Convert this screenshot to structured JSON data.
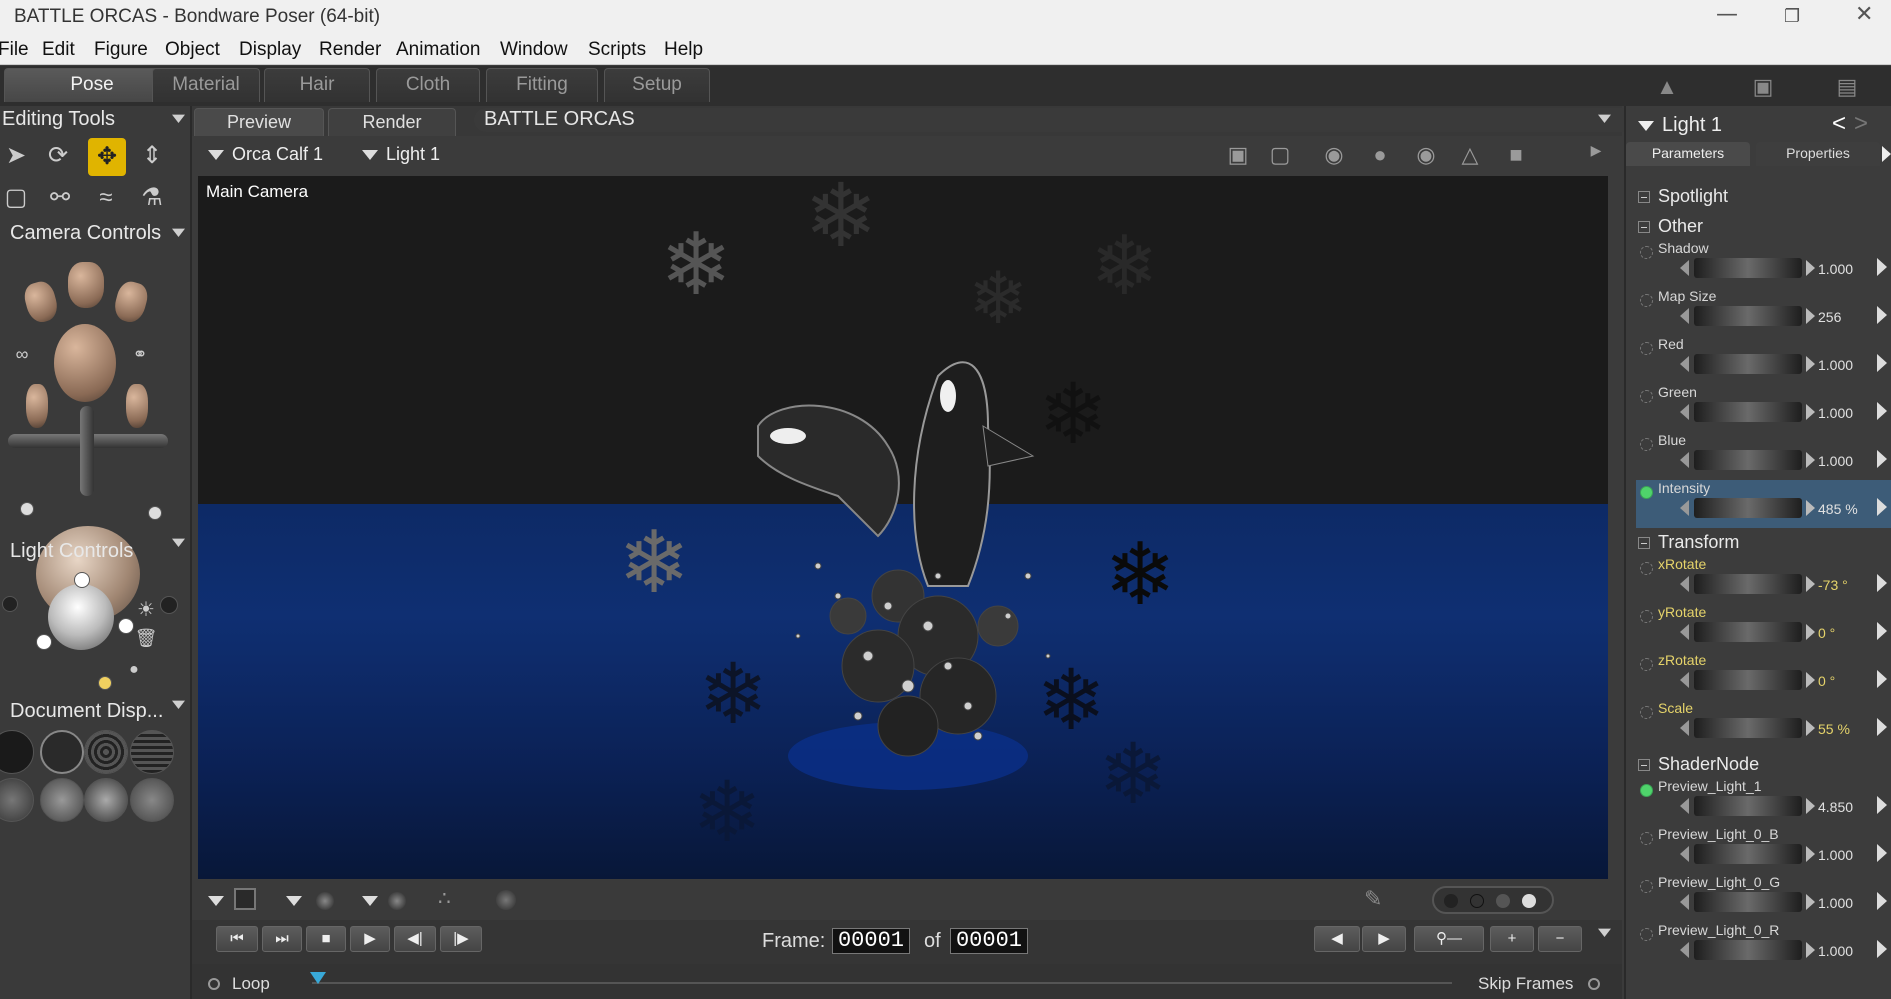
{
  "window": {
    "title": "BATTLE ORCAS - Bondware Poser (64-bit)"
  },
  "menu": [
    "File",
    "Edit",
    "Figure",
    "Object",
    "Display",
    "Render",
    "Animation",
    "Window",
    "Scripts",
    "Help"
  ],
  "rooms": [
    "Pose",
    "Material",
    "Hair",
    "Cloth",
    "Fitting",
    "Setup"
  ],
  "left": {
    "editing_tools": "Editing Tools",
    "camera_controls": "Camera Controls",
    "light_controls": "Light Controls",
    "document_display": "Document Disp..."
  },
  "viewport": {
    "tabs": [
      "Preview",
      "Render"
    ],
    "doc_title": "BATTLE ORCAS",
    "figure_select": "Orca Calf 1",
    "actor_select": "Light 1",
    "camera_label": "Main Camera"
  },
  "playback": {
    "frame_label": "Frame:",
    "frame_value": "00001",
    "of_label": "of",
    "total_frames": "00001",
    "loop_label": "Loop",
    "skip_frames_label": "Skip Frames"
  },
  "panel": {
    "title": "Light 1",
    "tabs": [
      "Parameters",
      "Properties"
    ],
    "sections": {
      "spotlight": "Spotlight",
      "other": "Other",
      "transform": "Transform",
      "shader": "ShaderNode"
    },
    "other_params": [
      {
        "label": "Shadow",
        "value": "1.000"
      },
      {
        "label": "Map Size",
        "value": "256"
      },
      {
        "label": "Red",
        "value": "1.000"
      },
      {
        "label": "Green",
        "value": "1.000"
      },
      {
        "label": "Blue",
        "value": "1.000"
      },
      {
        "label": "Intensity",
        "value": "485 %"
      }
    ],
    "transform_params": [
      {
        "label": "xRotate",
        "value": "-73 °"
      },
      {
        "label": "yRotate",
        "value": "0 °"
      },
      {
        "label": "zRotate",
        "value": "0 °"
      },
      {
        "label": "Scale",
        "value": "55 %"
      }
    ],
    "shader_params": [
      {
        "label": "Preview_Light_1",
        "value": "4.850"
      },
      {
        "label": "Preview_Light_0_B",
        "value": "1.000"
      },
      {
        "label": "Preview_Light_0_G",
        "value": "1.000"
      },
      {
        "label": "Preview_Light_0_R",
        "value": "1.000"
      }
    ]
  },
  "colors": {
    "accent": "#e0b400",
    "ocean": "#0f2f72",
    "keyed": "#4fd36b",
    "highlight": "#3d5c78"
  }
}
